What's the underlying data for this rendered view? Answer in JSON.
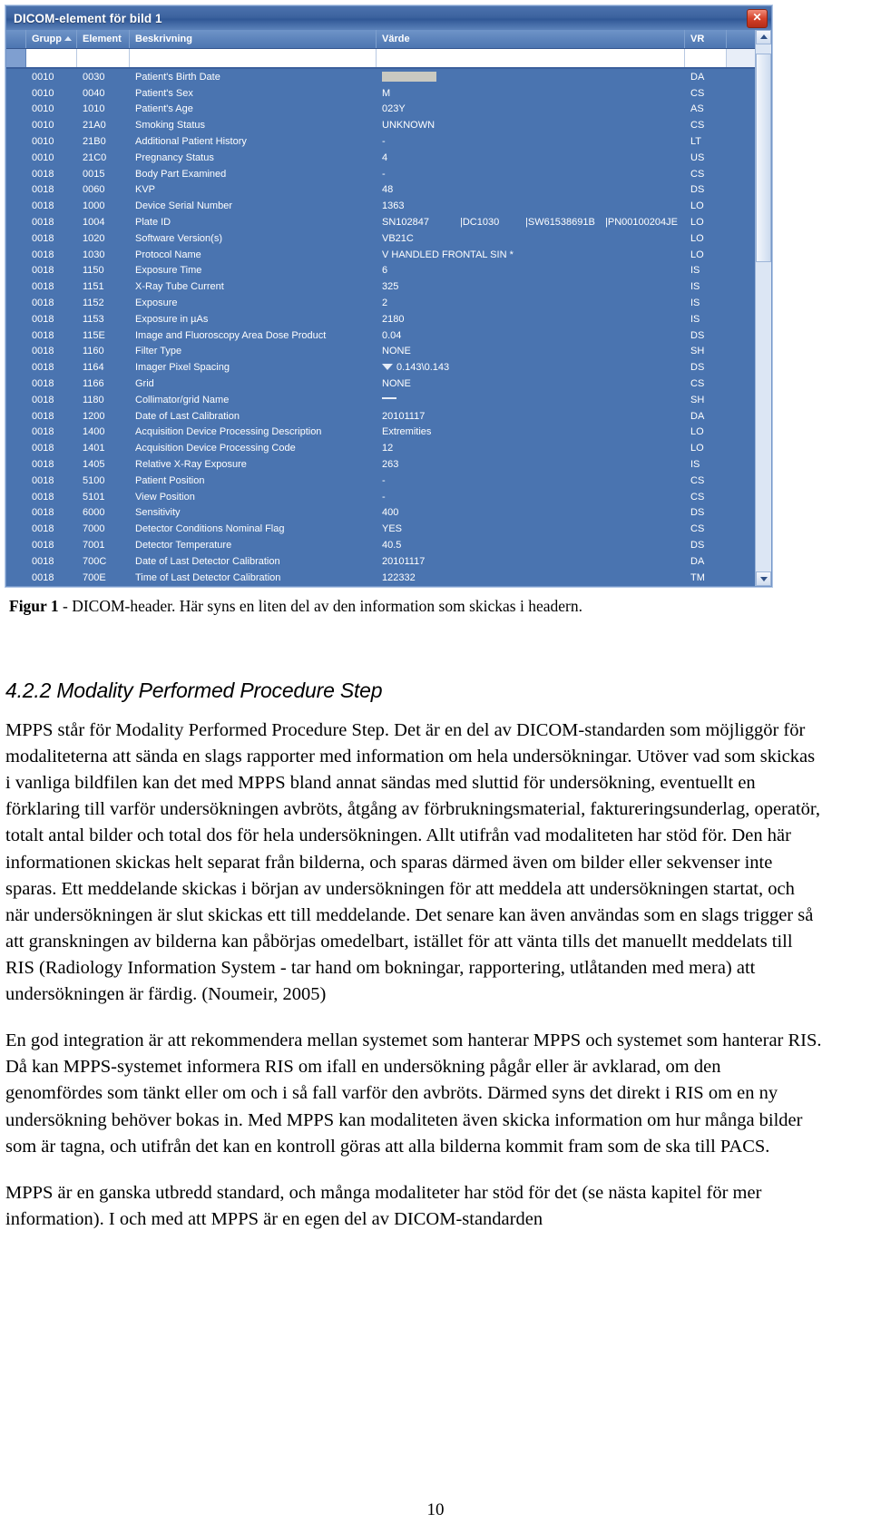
{
  "window": {
    "title": "DICOM-element för bild 1",
    "close_label": "✕"
  },
  "grid": {
    "columns": [
      "Grupp",
      "Element",
      "Beskrivning",
      "Värde",
      "VR"
    ],
    "sorted_column": "Grupp",
    "rows": [
      {
        "group": "0010",
        "element": "0030",
        "description": "Patient's Birth Date",
        "value": "",
        "value_kind": "redacted",
        "vr": "DA"
      },
      {
        "group": "0010",
        "element": "0040",
        "description": "Patient's Sex",
        "value": "M",
        "value_kind": "text",
        "vr": "CS"
      },
      {
        "group": "0010",
        "element": "1010",
        "description": "Patient's Age",
        "value": "023Y",
        "value_kind": "text",
        "vr": "AS"
      },
      {
        "group": "0010",
        "element": "21A0",
        "description": "Smoking Status",
        "value": "UNKNOWN",
        "value_kind": "text",
        "vr": "CS"
      },
      {
        "group": "0010",
        "element": "21B0",
        "description": "Additional Patient History",
        "value": "-",
        "value_kind": "text",
        "vr": "LT"
      },
      {
        "group": "0010",
        "element": "21C0",
        "description": "Pregnancy Status",
        "value": "4",
        "value_kind": "text",
        "vr": "US"
      },
      {
        "group": "0018",
        "element": "0015",
        "description": "Body Part Examined",
        "value": "-",
        "value_kind": "text",
        "vr": "CS"
      },
      {
        "group": "0018",
        "element": "0060",
        "description": "KVP",
        "value": "48",
        "value_kind": "text",
        "vr": "DS"
      },
      {
        "group": "0018",
        "element": "1000",
        "description": "Device Serial Number",
        "value": "1363",
        "value_kind": "text",
        "vr": "LO"
      },
      {
        "group": "0018",
        "element": "1004",
        "description": "Plate ID",
        "value": "SN102847   |DC1030   |SW61538691B   |PN00100204JE",
        "value_kind": "multipart",
        "value_parts": [
          "SN102847",
          "|DC1030",
          "|SW61538691B",
          "|PN00100204JE"
        ],
        "vr": "LO"
      },
      {
        "group": "0018",
        "element": "1020",
        "description": "Software Version(s)",
        "value": "VB21C",
        "value_kind": "text",
        "vr": "LO"
      },
      {
        "group": "0018",
        "element": "1030",
        "description": "Protocol Name",
        "value": "V HANDLED FRONTAL SIN *",
        "value_kind": "text",
        "vr": "LO"
      },
      {
        "group": "0018",
        "element": "1150",
        "description": "Exposure Time",
        "value": "6",
        "value_kind": "text",
        "vr": "IS"
      },
      {
        "group": "0018",
        "element": "1151",
        "description": "X-Ray Tube Current",
        "value": "325",
        "value_kind": "text",
        "vr": "IS"
      },
      {
        "group": "0018",
        "element": "1152",
        "description": "Exposure",
        "value": "2",
        "value_kind": "text",
        "vr": "IS"
      },
      {
        "group": "0018",
        "element": "1153",
        "description": "Exposure in µAs",
        "value": "2180",
        "value_kind": "text",
        "vr": "IS"
      },
      {
        "group": "0018",
        "element": "115E",
        "description": "Image and Fluoroscopy Area Dose Product",
        "value": "0.04",
        "value_kind": "text",
        "vr": "DS"
      },
      {
        "group": "0018",
        "element": "1160",
        "description": "Filter Type",
        "value": "NONE",
        "value_kind": "text",
        "vr": "SH"
      },
      {
        "group": "0018",
        "element": "1164",
        "description": "Imager Pixel Spacing",
        "value": "0.143\\0.143",
        "value_kind": "expandable",
        "vr": "DS"
      },
      {
        "group": "0018",
        "element": "1166",
        "description": "Grid",
        "value": "NONE",
        "value_kind": "text",
        "vr": "CS"
      },
      {
        "group": "0018",
        "element": "1180",
        "description": "Collimator/grid Name",
        "value": "—",
        "value_kind": "dash",
        "vr": "SH"
      },
      {
        "group": "0018",
        "element": "1200",
        "description": "Date of Last Calibration",
        "value": "20101117",
        "value_kind": "text",
        "vr": "DA"
      },
      {
        "group": "0018",
        "element": "1400",
        "description": "Acquisition Device Processing Description",
        "value": "Extremities",
        "value_kind": "text",
        "vr": "LO"
      },
      {
        "group": "0018",
        "element": "1401",
        "description": "Acquisition Device Processing Code",
        "value": "12",
        "value_kind": "text",
        "vr": "LO"
      },
      {
        "group": "0018",
        "element": "1405",
        "description": "Relative X-Ray Exposure",
        "value": "263",
        "value_kind": "text",
        "vr": "IS"
      },
      {
        "group": "0018",
        "element": "5100",
        "description": "Patient Position",
        "value": "-",
        "value_kind": "text",
        "vr": "CS"
      },
      {
        "group": "0018",
        "element": "5101",
        "description": "View Position",
        "value": "-",
        "value_kind": "text",
        "vr": "CS"
      },
      {
        "group": "0018",
        "element": "6000",
        "description": "Sensitivity",
        "value": "400",
        "value_kind": "text",
        "vr": "DS"
      },
      {
        "group": "0018",
        "element": "7000",
        "description": "Detector Conditions Nominal Flag",
        "value": "YES",
        "value_kind": "text",
        "vr": "CS"
      },
      {
        "group": "0018",
        "element": "7001",
        "description": "Detector Temperature",
        "value": "40.5",
        "value_kind": "text",
        "vr": "DS"
      },
      {
        "group": "0018",
        "element": "700C",
        "description": "Date of Last Detector Calibration",
        "value": "20101117",
        "value_kind": "text",
        "vr": "DA"
      },
      {
        "group": "0018",
        "element": "700E",
        "description": "Time of Last Detector Calibration",
        "value": "122332",
        "value_kind": "text",
        "vr": "TM"
      }
    ]
  },
  "caption": {
    "label": "Figur 1",
    "text": " - DICOM-header. Här syns en liten del av den information som skickas i headern."
  },
  "document": {
    "section_heading": "4.2.2 Modality Performed Procedure Step",
    "paragraphs": [
      "MPPS står för Modality Performed Procedure Step. Det är en del av DICOM-standarden som möjliggör för modaliteterna att sända en slags rapporter med information om hela undersökningar. Utöver vad som skickas i vanliga bildfilen kan det med MPPS bland annat sändas med sluttid för undersökning, eventuellt en förklaring till varför undersökningen avbröts, åtgång av förbrukningsmaterial, faktureringsunderlag, operatör, totalt antal bilder och total dos för hela undersökningen. Allt utifrån vad modaliteten har stöd för. Den här informationen skickas helt separat från bilderna, och sparas därmed även om bilder eller sekvenser inte sparas. Ett meddelande skickas i början av undersökningen för att meddela att undersökningen startat, och när undersökningen är slut skickas ett till meddelande. Det senare kan även användas som en slags trigger så att granskningen av bilderna kan påbörjas omedelbart, istället för att vänta tills det manuellt meddelats till RIS (Radiology Information System - tar hand om bokningar, rapportering, utlåtanden med mera) att undersökningen är färdig. (Noumeir, 2005)",
      "En god integration är att rekommendera mellan systemet som hanterar MPPS och systemet som hanterar RIS. Då kan MPPS-systemet informera RIS om ifall en undersökning pågår eller är avklarad, om den genomfördes som tänkt eller om och i så fall varför den avbröts. Därmed syns det direkt i RIS om en ny undersökning behöver bokas in. Med MPPS kan modaliteten även skicka information om hur många bilder som är tagna, och utifrån det kan en kontroll göras att alla bilderna kommit fram som de ska till PACS.",
      "MPPS är en ganska utbredd standard, och många modaliteter har stöd för det (se nästa kapitel för mer information). I och med att MPPS är en egen del av DICOM-standarden"
    ],
    "page_number": "10"
  },
  "colors": {
    "grid_background": "#4a74b0",
    "title_bar": "#3d639f",
    "close_button": "#d4412a",
    "header_row": "#5d84bc"
  }
}
